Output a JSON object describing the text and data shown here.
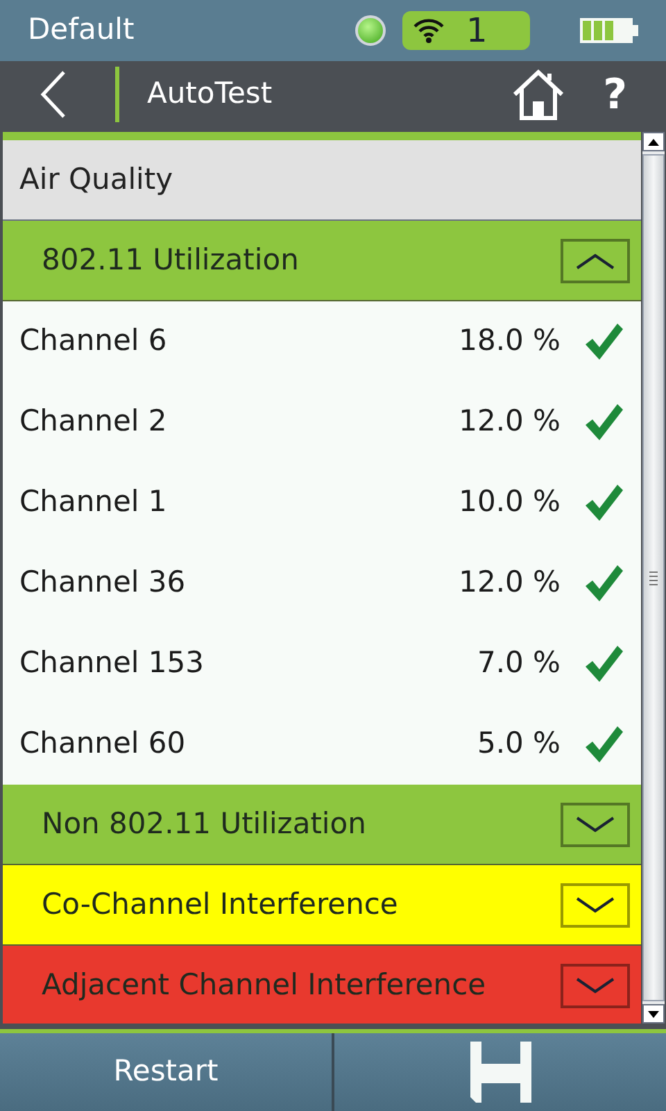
{
  "status_bar": {
    "profile": "Default",
    "link_ok": true,
    "wifi_count": "1"
  },
  "nav": {
    "title": "AutoTest",
    "help": "?"
  },
  "sections": [
    {
      "kind": "category",
      "title": "Air Quality"
    },
    {
      "kind": "group",
      "title": "802.11 Utilization",
      "color": "#8dc63f",
      "expanded": true,
      "items": [
        {
          "name": "Channel 6",
          "value": "18.0 %",
          "passed": true
        },
        {
          "name": "Channel 2",
          "value": "12.0 %",
          "passed": true
        },
        {
          "name": "Channel 1",
          "value": "10.0 %",
          "passed": true
        },
        {
          "name": "Channel 36",
          "value": "12.0 %",
          "passed": true
        },
        {
          "name": "Channel 153",
          "value": "7.0 %",
          "passed": true
        },
        {
          "name": "Channel 60",
          "value": "5.0 %",
          "passed": true
        }
      ]
    },
    {
      "kind": "group",
      "title": "Non 802.11 Utilization",
      "color": "#8dc63f",
      "expanded": false
    },
    {
      "kind": "group",
      "title": "Co-Channel Interference",
      "color": "#ffff00",
      "expanded": false
    },
    {
      "kind": "group",
      "title": "Adjacent Channel Interference",
      "color": "#e8392e",
      "expanded": false
    }
  ],
  "buttons": [
    {
      "kind": "text",
      "label": "Restart"
    },
    {
      "kind": "save"
    }
  ]
}
